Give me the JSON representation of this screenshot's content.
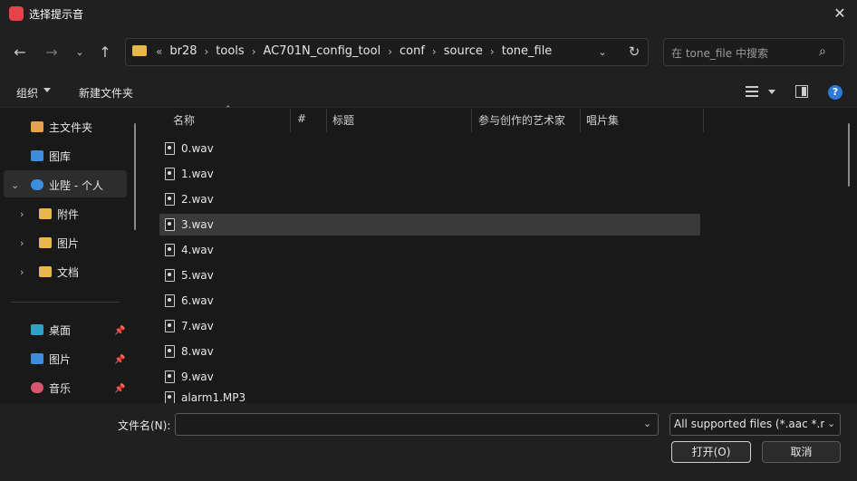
{
  "window": {
    "title": "选择提示音"
  },
  "address": {
    "crumbs": [
      "br28",
      "tools",
      "AC701N_config_tool",
      "conf",
      "source",
      "tone_file"
    ],
    "overflow": "«"
  },
  "search": {
    "placeholder": "在 tone_file 中搜索"
  },
  "toolbar": {
    "organize": "组织",
    "new_folder": "新建文件夹"
  },
  "sidebar": {
    "items": [
      {
        "label": "主文件夹",
        "icon": "home-icon",
        "color": "#e6a24a"
      },
      {
        "label": "图库",
        "icon": "gallery-icon",
        "color": "#3c8ddb"
      },
      {
        "label": "业陛 - 个人",
        "icon": "onedrive-icon",
        "color": "#3c8ddb"
      },
      {
        "label": "附件",
        "icon": "folder-icon",
        "color": "#e8b74a"
      },
      {
        "label": "图片",
        "icon": "folder-icon",
        "color": "#e8b74a"
      },
      {
        "label": "文档",
        "icon": "folder-icon",
        "color": "#e8b74a"
      }
    ],
    "quick": [
      {
        "label": "桌面",
        "icon": "desktop-icon",
        "color": "#2fa3c7"
      },
      {
        "label": "图片",
        "icon": "pictures-icon",
        "color": "#3c8ddb"
      },
      {
        "label": "音乐",
        "icon": "music-icon",
        "color": "#d8556b"
      }
    ]
  },
  "columns": [
    "名称",
    "#",
    "标题",
    "参与创作的艺术家",
    "唱片集"
  ],
  "files": [
    "0.wav",
    "1.wav",
    "2.wav",
    "3.wav",
    "4.wav",
    "5.wav",
    "6.wav",
    "7.wav",
    "8.wav",
    "9.wav",
    "alarm1.MP3"
  ],
  "selected_file": "3.wav",
  "footer": {
    "filename_label": "文件名(N):",
    "filename_value": "",
    "filter": "All supported files (*.aac *.m",
    "open": "打开(O)",
    "cancel": "取消"
  }
}
